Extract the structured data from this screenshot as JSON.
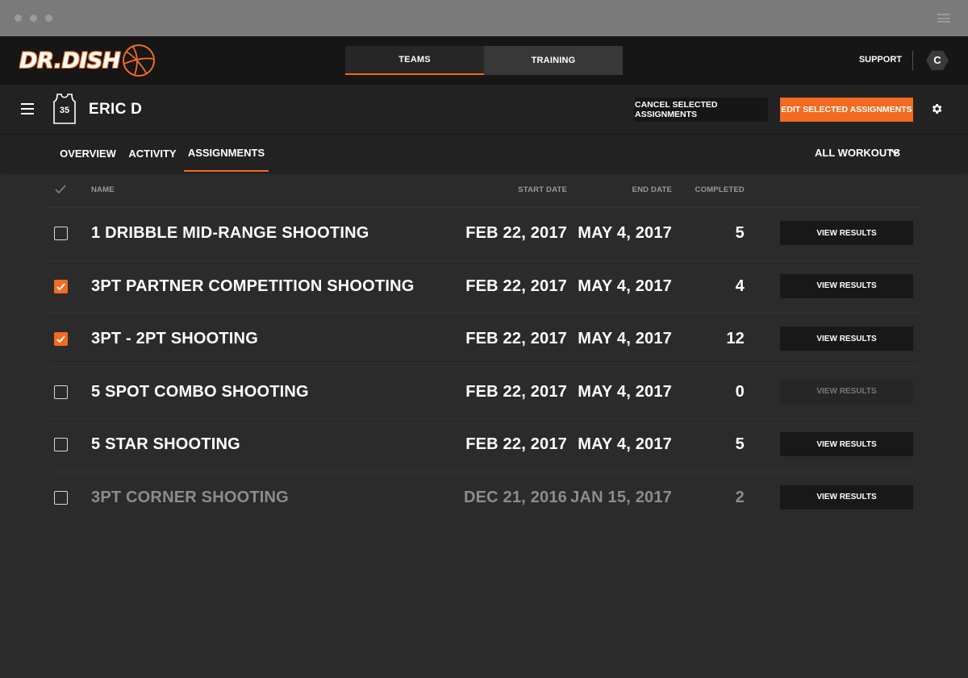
{
  "app": {
    "logo_text": "DR.DISH",
    "nav_tabs": [
      {
        "label": "TEAMS",
        "active": true
      },
      {
        "label": "TRAINING",
        "active": false
      }
    ],
    "support_label": "SUPPORT",
    "user_initial": "C"
  },
  "player": {
    "jersey_number": "35",
    "name": "ERIC D",
    "cancel_button": "CANCEL SELECTED ASSIGNMENTS",
    "edit_button": "EDIT SELECTED ASSIGNMENTS"
  },
  "tabs": [
    {
      "label": "OVERVIEW",
      "active": false
    },
    {
      "label": "ACTIVITY",
      "active": false
    },
    {
      "label": "ASSIGNMENTS",
      "active": true
    }
  ],
  "filter": {
    "selected": "ALL WORKOUTS"
  },
  "table": {
    "headers": {
      "name": "NAME",
      "start": "START DATE",
      "end": "END DATE",
      "completed": "COMPLETED"
    },
    "view_results_label": "VIEW RESULTS",
    "rows": [
      {
        "name": "1 DRIBBLE MID-RANGE SHOOTING",
        "start": "FEB 22, 2017",
        "end": "MAY 4, 2017",
        "completed": "5",
        "checked": false,
        "faded": false,
        "results_enabled": true
      },
      {
        "name": "3PT PARTNER COMPETITION SHOOTING",
        "start": "FEB 22, 2017",
        "end": "MAY 4, 2017",
        "completed": "4",
        "checked": true,
        "faded": false,
        "results_enabled": true
      },
      {
        "name": "3PT - 2PT SHOOTING",
        "start": "FEB 22, 2017",
        "end": "MAY 4, 2017",
        "completed": "12",
        "checked": true,
        "faded": false,
        "results_enabled": true
      },
      {
        "name": "5 SPOT COMBO SHOOTING",
        "start": "FEB 22, 2017",
        "end": "MAY 4, 2017",
        "completed": "0",
        "checked": false,
        "faded": false,
        "results_enabled": false
      },
      {
        "name": "5 STAR SHOOTING",
        "start": "FEB 22, 2017",
        "end": "MAY 4, 2017",
        "completed": "5",
        "checked": false,
        "faded": false,
        "results_enabled": true
      },
      {
        "name": "3PT CORNER SHOOTING",
        "start": "DEC 21, 2016",
        "end": "JAN 15, 2017",
        "completed": "2",
        "checked": false,
        "faded": true,
        "results_enabled": true
      }
    ]
  },
  "colors": {
    "accent": "#f26b21",
    "background": "#2b2b2b",
    "header": "#161616"
  }
}
